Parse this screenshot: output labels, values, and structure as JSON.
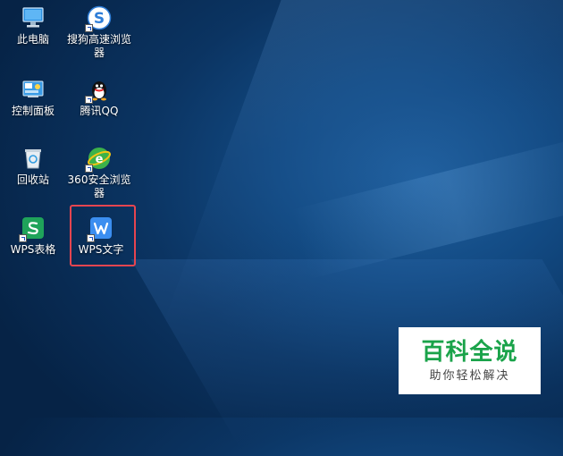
{
  "desktop": {
    "icons": [
      {
        "label": "此电脑",
        "icon": "computer-icon"
      },
      {
        "label": "搜狗高速浏览器",
        "icon": "sogou-browser-icon"
      },
      {
        "label": "控制面板",
        "icon": "control-panel-icon"
      },
      {
        "label": "腾讯QQ",
        "icon": "qq-penguin-icon"
      },
      {
        "label": "回收站",
        "icon": "recycle-bin-icon"
      },
      {
        "label": "360安全浏览器",
        "icon": "360-browser-icon"
      },
      {
        "label": "WPS表格",
        "icon": "wps-spreadsheet-icon"
      },
      {
        "label": "WPS文字",
        "icon": "wps-writer-icon"
      }
    ],
    "highlighted_icon": "WPS文字",
    "highlight_color": "#e64550"
  },
  "watermark": {
    "title": "百科全说",
    "subtitle": "助你轻松解决",
    "title_color": "#1aa34a"
  }
}
